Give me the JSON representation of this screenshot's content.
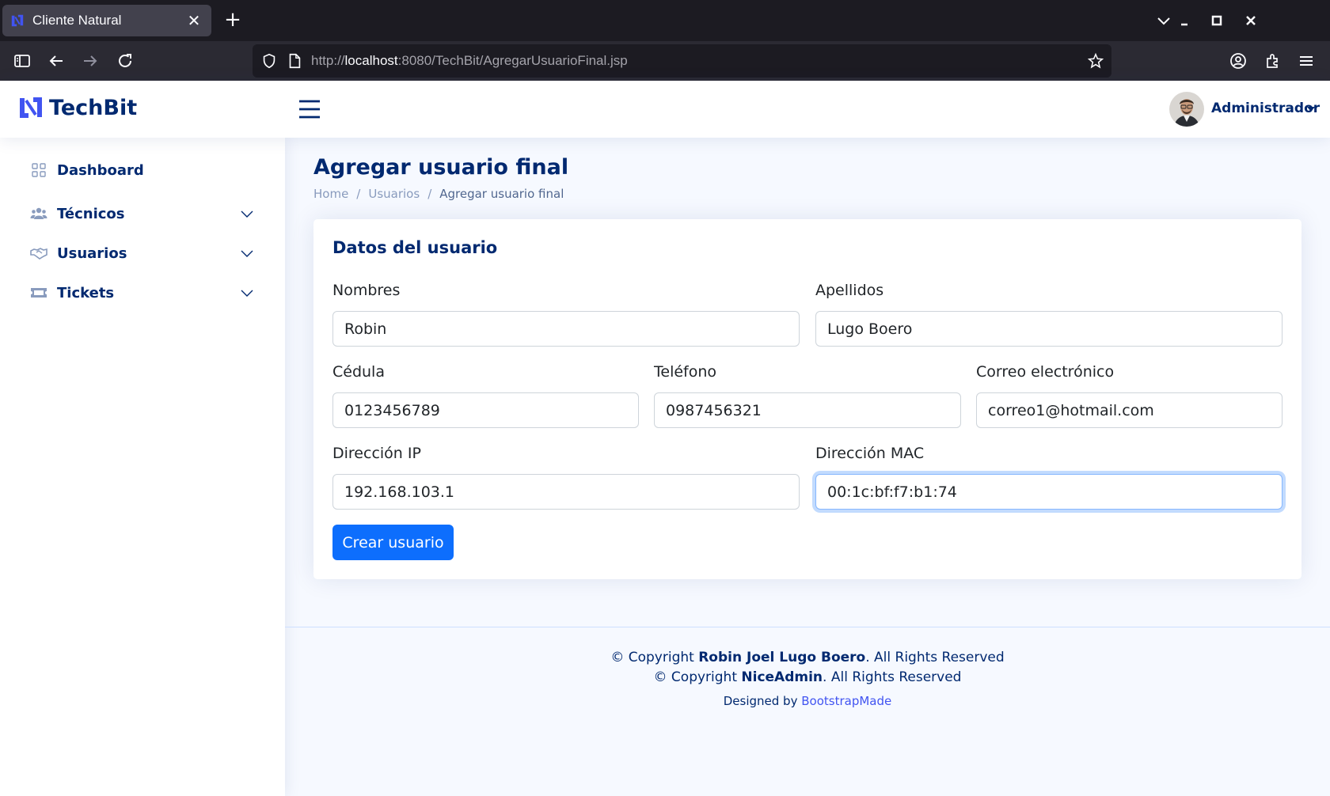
{
  "browser": {
    "tab_title": "Cliente Natural",
    "url_prefix": "http://",
    "url_host": "localhost",
    "url_rest": ":8080/TechBit/AgregarUsuarioFinal.jsp"
  },
  "header": {
    "logo_text": "TechBit",
    "profile_name": "Administrador"
  },
  "sidebar": {
    "items": [
      {
        "label": "Dashboard",
        "icon": "grid-icon"
      },
      {
        "label": "Técnicos",
        "icon": "people-icon"
      },
      {
        "label": "Usuarios",
        "icon": "handshake-icon"
      },
      {
        "label": "Tickets",
        "icon": "ticket-icon"
      }
    ]
  },
  "page": {
    "title": "Agregar usuario final",
    "breadcrumb": [
      "Home",
      "Usuarios",
      "Agregar usuario final"
    ]
  },
  "form": {
    "card_title": "Datos del usuario",
    "fields": {
      "nombres": {
        "label": "Nombres",
        "value": "Robin"
      },
      "apellidos": {
        "label": "Apellidos",
        "value": "Lugo Boero"
      },
      "cedula": {
        "label": "Cédula",
        "value": "0123456789"
      },
      "telefono": {
        "label": "Teléfono",
        "value": "0987456321"
      },
      "correo": {
        "label": "Correo electrónico",
        "value": "correo1@hotmail.com"
      },
      "ip": {
        "label": "Dirección IP",
        "value": "192.168.103.1"
      },
      "mac": {
        "label": "Dirección MAC",
        "value": "00:1c:bf:f7:b1:74"
      }
    },
    "submit_label": "Crear usuario"
  },
  "footer": {
    "copyright_prefix": "© Copyright ",
    "author": "Robin Joel Lugo Boero",
    "rights": ". All Rights Reserved",
    "template_name": "NiceAdmin",
    "designed_by": "Designed by ",
    "designer": "BootstrapMade"
  },
  "colors": {
    "brand": "#012970",
    "accent": "#4154f1",
    "primary_button": "#0d6efd"
  }
}
